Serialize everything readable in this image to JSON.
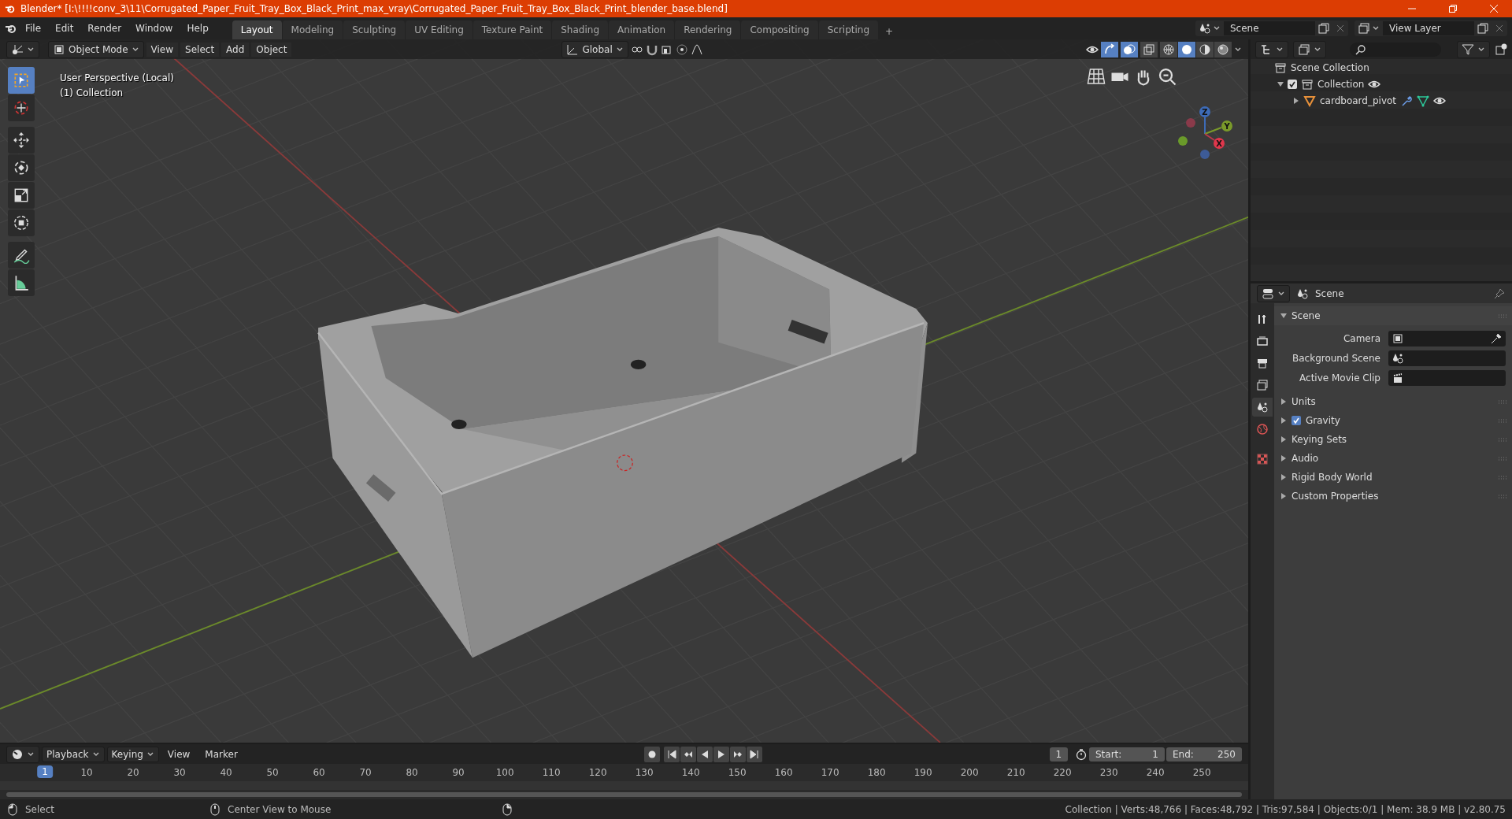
{
  "window": {
    "title": "Blender* [I:\\!!!!conv_3\\11\\Corrugated_Paper_Fruit_Tray_Box_Black_Print_max_vray\\Corrugated_Paper_Fruit_Tray_Box_Black_Print_blender_base.blend]"
  },
  "menu": [
    "File",
    "Edit",
    "Render",
    "Window",
    "Help"
  ],
  "workspaces": [
    {
      "label": "Layout",
      "selected": true
    },
    {
      "label": "Modeling",
      "selected": false
    },
    {
      "label": "Sculpting",
      "selected": false
    },
    {
      "label": "UV Editing",
      "selected": false
    },
    {
      "label": "Texture Paint",
      "selected": false
    },
    {
      "label": "Shading",
      "selected": false
    },
    {
      "label": "Animation",
      "selected": false
    },
    {
      "label": "Rendering",
      "selected": false
    },
    {
      "label": "Compositing",
      "selected": false
    },
    {
      "label": "Scripting",
      "selected": false
    }
  ],
  "add_workspace": "+",
  "scene_selector": {
    "value": "Scene"
  },
  "view_layer_selector": {
    "value": "View Layer"
  },
  "viewport": {
    "mode": "Object Mode",
    "menus": [
      "View",
      "Select",
      "Add",
      "Object"
    ],
    "orientation": "Global",
    "shading": [
      {
        "kind": "wireframe",
        "selected": false
      },
      {
        "kind": "solid",
        "selected": true
      },
      {
        "kind": "material",
        "selected": false
      },
      {
        "kind": "rendered",
        "selected": false
      }
    ],
    "overlay_text": [
      "User Perspective (Local)",
      "(1) Collection"
    ],
    "tools": [
      {
        "kind": "select",
        "selected": true
      },
      {
        "kind": "cursor",
        "selected": false
      },
      {
        "kind": "move",
        "selected": false
      },
      {
        "kind": "rotate",
        "selected": false
      },
      {
        "kind": "scale",
        "selected": false
      },
      {
        "kind": "transform",
        "selected": false
      },
      {
        "kind": "annotate",
        "selected": false
      },
      {
        "kind": "measure",
        "selected": false
      }
    ],
    "gizmo": [
      {
        "label": "Z"
      },
      {
        "label": "Y"
      },
      {
        "label": "X"
      }
    ]
  },
  "outliner": {
    "items": [
      {
        "label": "Scene Collection",
        "children": [
          {
            "label": "Collection",
            "checked": true,
            "expanded": true,
            "children": [
              {
                "label": "cardboard_pivot",
                "expanded": false
              }
            ]
          }
        ]
      }
    ]
  },
  "properties": {
    "title": "Scene",
    "tabs": [
      {
        "kind": "tool",
        "selected": false
      },
      {
        "kind": "render",
        "selected": false
      },
      {
        "kind": "output",
        "selected": false
      },
      {
        "kind": "view_layer",
        "selected": false
      },
      {
        "kind": "scene",
        "selected": true
      },
      {
        "kind": "world",
        "selected": false
      },
      {
        "kind": "texture",
        "selected": false
      }
    ],
    "panel": {
      "title": "Scene",
      "expanded": true,
      "fields": [
        {
          "kind": "object",
          "label": "Camera"
        },
        {
          "kind": "scene",
          "label": "Background Scene"
        },
        {
          "kind": "clip",
          "label": "Active Movie Clip"
        }
      ]
    },
    "sections": [
      {
        "kind": "plain",
        "label": "Units"
      },
      {
        "kind": "checkbox",
        "label": "Gravity",
        "checked": true
      },
      {
        "kind": "plain",
        "label": "Keying Sets"
      },
      {
        "kind": "plain",
        "label": "Audio"
      },
      {
        "kind": "plain",
        "label": "Rigid Body World"
      },
      {
        "kind": "plain",
        "label": "Custom Properties"
      }
    ]
  },
  "timeline": {
    "menus": [
      "Playback",
      "Keying",
      "View",
      "Marker"
    ],
    "current_frame": "1",
    "start": {
      "label": "Start:",
      "value": "1"
    },
    "end": {
      "label": "End:",
      "value": "250"
    },
    "ticks": [
      {
        "label": "1",
        "selected": true
      },
      {
        "label": "10",
        "selected": false
      },
      {
        "label": "20",
        "selected": false
      },
      {
        "label": "30",
        "selected": false
      },
      {
        "label": "40",
        "selected": false
      },
      {
        "label": "50",
        "selected": false
      },
      {
        "label": "60",
        "selected": false
      },
      {
        "label": "70",
        "selected": false
      },
      {
        "label": "80",
        "selected": false
      },
      {
        "label": "90",
        "selected": false
      },
      {
        "label": "100",
        "selected": false
      },
      {
        "label": "110",
        "selected": false
      },
      {
        "label": "120",
        "selected": false
      },
      {
        "label": "130",
        "selected": false
      },
      {
        "label": "140",
        "selected": false
      },
      {
        "label": "150",
        "selected": false
      },
      {
        "label": "160",
        "selected": false
      },
      {
        "label": "170",
        "selected": false
      },
      {
        "label": "180",
        "selected": false
      },
      {
        "label": "190",
        "selected": false
      },
      {
        "label": "200",
        "selected": false
      },
      {
        "label": "210",
        "selected": false
      },
      {
        "label": "220",
        "selected": false
      },
      {
        "label": "230",
        "selected": false
      },
      {
        "label": "240",
        "selected": false
      },
      {
        "label": "250",
        "selected": false
      }
    ]
  },
  "status_bar": {
    "hints": [
      "Select",
      "Center View to Mouse"
    ],
    "stats": "Collection | Verts:48,766 | Faces:48,792 | Tris:97,584 | Objects:0/1 | Mem: 38.9 MB | v2.80.75"
  }
}
